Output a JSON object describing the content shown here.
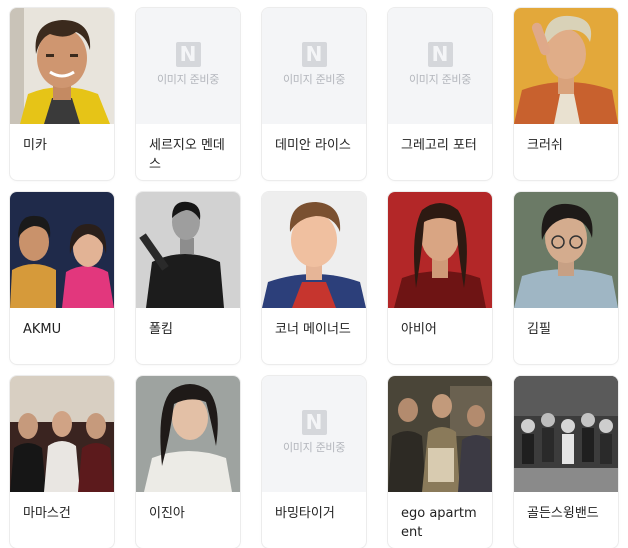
{
  "placeholder": {
    "logo_letter": "N",
    "text": "이미지 준비중"
  },
  "artists": [
    {
      "name": "미카",
      "image": "photo-portrait"
    },
    {
      "name": "세르지오 멘데스",
      "image": "placeholder"
    },
    {
      "name": "데미안 라이스",
      "image": "placeholder"
    },
    {
      "name": "그레고리 포터",
      "image": "placeholder"
    },
    {
      "name": "크러쉬",
      "image": "photo-portrait"
    },
    {
      "name": "AKMU",
      "image": "photo-duo"
    },
    {
      "name": "폴킴",
      "image": "photo-portrait"
    },
    {
      "name": "코너 메이너드",
      "image": "photo-portrait"
    },
    {
      "name": "아비어",
      "image": "photo-portrait"
    },
    {
      "name": "김필",
      "image": "photo-portrait"
    },
    {
      "name": "마마스건",
      "image": "photo-band"
    },
    {
      "name": "이진아",
      "image": "photo-portrait"
    },
    {
      "name": "바밍타이거",
      "image": "placeholder"
    },
    {
      "name": "ego apartment",
      "image": "photo-band"
    },
    {
      "name": "골든스윙밴드",
      "image": "photo-band"
    }
  ]
}
